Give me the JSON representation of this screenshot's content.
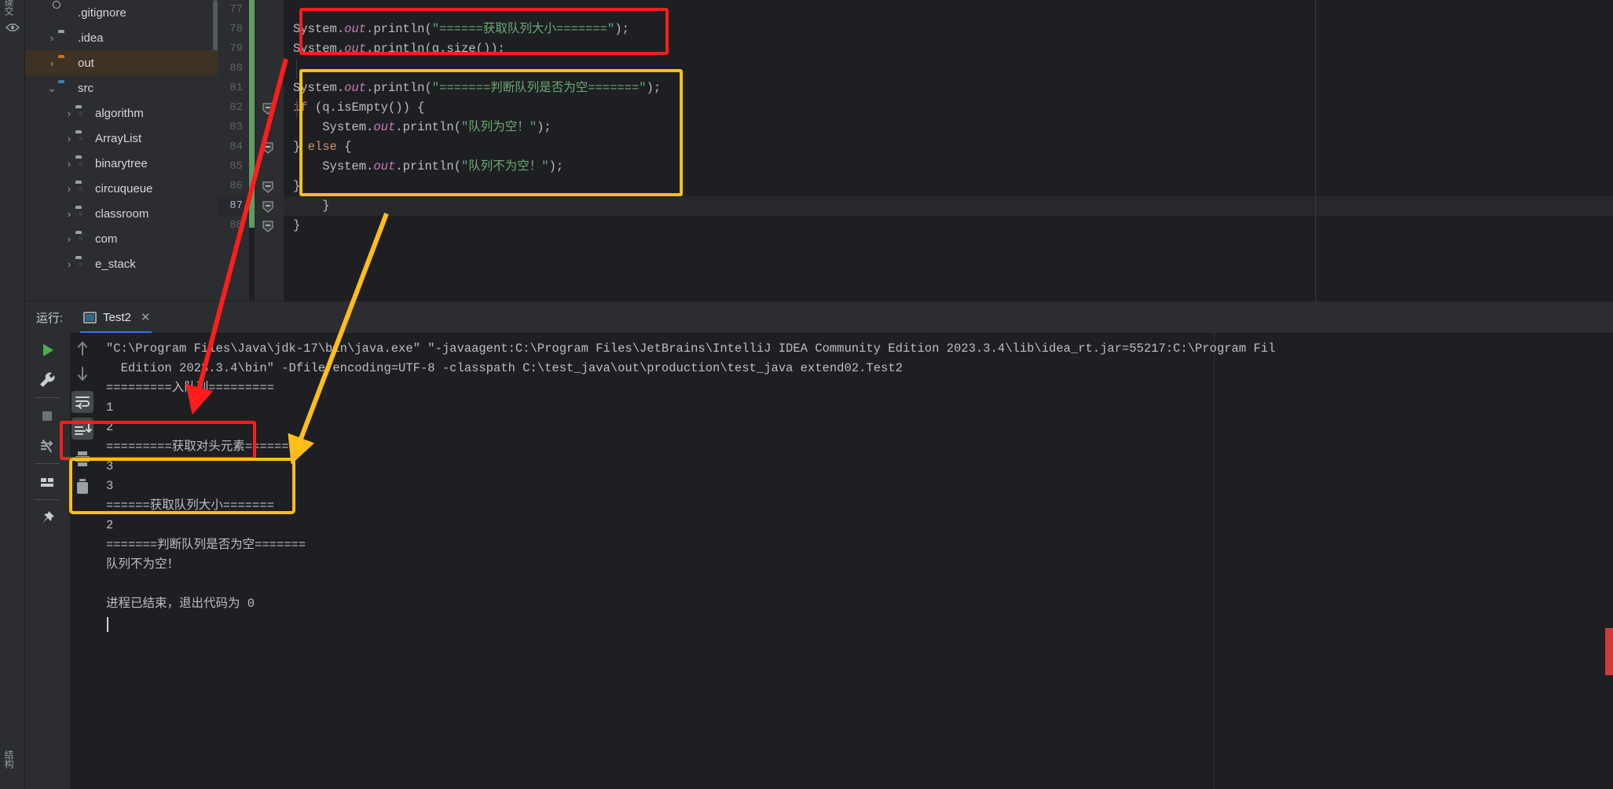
{
  "app": {
    "left_strip": {
      "top_label": "提交",
      "bottom_label": "结构",
      "bookmark_icon": "bookmark-icon"
    }
  },
  "project_tree": {
    "items": [
      {
        "label": ".gitignore",
        "indent": 1,
        "arrow": "",
        "icon": "file-icon",
        "selected": false
      },
      {
        "label": ".idea",
        "indent": 1,
        "arrow": "›",
        "icon": "folder-icon",
        "selected": false
      },
      {
        "label": "out",
        "indent": 1,
        "arrow": "›",
        "icon": "folder-orange-icon",
        "selected": true
      },
      {
        "label": "src",
        "indent": 1,
        "arrow": "⌄",
        "icon": "folder-blue-icon",
        "selected": false
      },
      {
        "label": "algorithm",
        "indent": 2,
        "arrow": "›",
        "icon": "folder-module-icon",
        "selected": false
      },
      {
        "label": "ArrayList",
        "indent": 2,
        "arrow": "›",
        "icon": "folder-module-icon",
        "selected": false
      },
      {
        "label": "binarytree",
        "indent": 2,
        "arrow": "›",
        "icon": "folder-module-icon",
        "selected": false
      },
      {
        "label": "circuqueue",
        "indent": 2,
        "arrow": "›",
        "icon": "folder-module-icon",
        "selected": false
      },
      {
        "label": "classroom",
        "indent": 2,
        "arrow": "›",
        "icon": "folder-module-icon",
        "selected": false
      },
      {
        "label": "com",
        "indent": 2,
        "arrow": "›",
        "icon": "folder-module-icon",
        "selected": false
      },
      {
        "label": "e_stack",
        "indent": 2,
        "arrow": "›",
        "icon": "folder-module-icon",
        "selected": false
      }
    ]
  },
  "editor": {
    "line_numbers": [
      "77",
      "78",
      "79",
      "80",
      "81",
      "82",
      "83",
      "84",
      "85",
      "86",
      "87",
      "88"
    ],
    "current_line": "87",
    "lines": [
      {
        "n": "77",
        "text": ""
      },
      {
        "n": "78",
        "text": "System.out.println(\"======获取队列大小=======\");"
      },
      {
        "n": "79",
        "text": "System.out.println(q.size());"
      },
      {
        "n": "80",
        "text": ""
      },
      {
        "n": "81",
        "text": "System.out.println(\"=======判断队列是否为空=======\");"
      },
      {
        "n": "82",
        "text": "if (q.isEmpty()) {"
      },
      {
        "n": "83",
        "text": "    System.out.println(\"队列为空！\");"
      },
      {
        "n": "84",
        "text": "} else {"
      },
      {
        "n": "85",
        "text": "    System.out.println(\"队列不为空！\");"
      },
      {
        "n": "86",
        "text": "}"
      },
      {
        "n": "87",
        "text": "    }"
      },
      {
        "n": "88",
        "text": "}"
      }
    ]
  },
  "run_panel": {
    "label": "运行:",
    "tab_name": "Test2",
    "tab_close": "✕",
    "toolbar": [
      {
        "name": "run-button",
        "glyph": "▶"
      },
      {
        "name": "settings-button",
        "glyph": "🔧"
      },
      {
        "name": "stop-button",
        "glyph": "■"
      },
      {
        "name": "rerun-failed-button",
        "glyph": "↷"
      },
      {
        "name": "layout-button",
        "glyph": "▤"
      },
      {
        "name": "pin-button",
        "glyph": "📌"
      }
    ],
    "toolbar2": [
      {
        "name": "scroll-up-button",
        "glyph": "↑"
      },
      {
        "name": "scroll-down-button",
        "glyph": "↓"
      },
      {
        "name": "soft-wrap-button",
        "glyph": "⏎"
      },
      {
        "name": "scroll-to-end-button",
        "glyph": "⤓"
      },
      {
        "name": "print-button",
        "glyph": "🖨"
      },
      {
        "name": "clear-all-button",
        "glyph": "🗑"
      }
    ]
  },
  "console": {
    "lines": [
      {
        "text": "\"C:\\Program Files\\Java\\jdk-17\\bin\\java.exe\" \"-javaagent:C:\\Program Files\\JetBrains\\IntelliJ IDEA Community Edition 2023.3.4\\lib\\idea_rt.jar=55217:C:\\Program Fil"
      },
      {
        "text": "  Edition 2023.3.4\\bin\" -Dfile.encoding=UTF-8 -classpath C:\\test_java\\out\\production\\test_java extend02.Test2"
      },
      {
        "text": "=========入队列========="
      },
      {
        "text": "1"
      },
      {
        "text": "2"
      },
      {
        "text": "=========获取对头元素========"
      },
      {
        "text": "3"
      },
      {
        "text": "3"
      },
      {
        "text": "======获取队列大小======="
      },
      {
        "text": "2"
      },
      {
        "text": "=======判断队列是否为空======="
      },
      {
        "text": "队列不为空！"
      },
      {
        "text": ""
      },
      {
        "text": "进程已结束，退出代码为 0"
      }
    ]
  },
  "annotations": {
    "red_color": "#ff1d1d",
    "yellow_color": "#ffbe1a",
    "red_arrow_note": "red-arrow-code-to-output",
    "yellow_arrow_note": "yellow-arrow-code-to-output"
  }
}
